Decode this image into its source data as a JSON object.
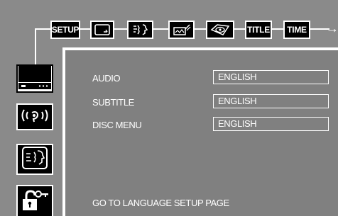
{
  "menu_tabs": [
    {
      "label": "SETUP",
      "icon": "setup"
    },
    {
      "label": "",
      "icon": "tv-screen-icon"
    },
    {
      "label": "",
      "icon": "speech-icon"
    },
    {
      "label": "",
      "icon": "video-icon"
    },
    {
      "label": "",
      "icon": "disc-eye-icon"
    },
    {
      "label": "TITLE",
      "icon": "title"
    },
    {
      "label": "TIME",
      "icon": "time"
    }
  ],
  "side_icons": [
    "tv-icon",
    "audio-icon",
    "language-icon",
    "lock-icon"
  ],
  "settings": [
    {
      "label": "AUDIO",
      "value": "ENGLISH"
    },
    {
      "label": "SUBTITLE",
      "value": "ENGLISH"
    },
    {
      "label": "DISC MENU",
      "value": "ENGLISH"
    }
  ],
  "footer": "GO TO LANGUAGE SETUP PAGE"
}
